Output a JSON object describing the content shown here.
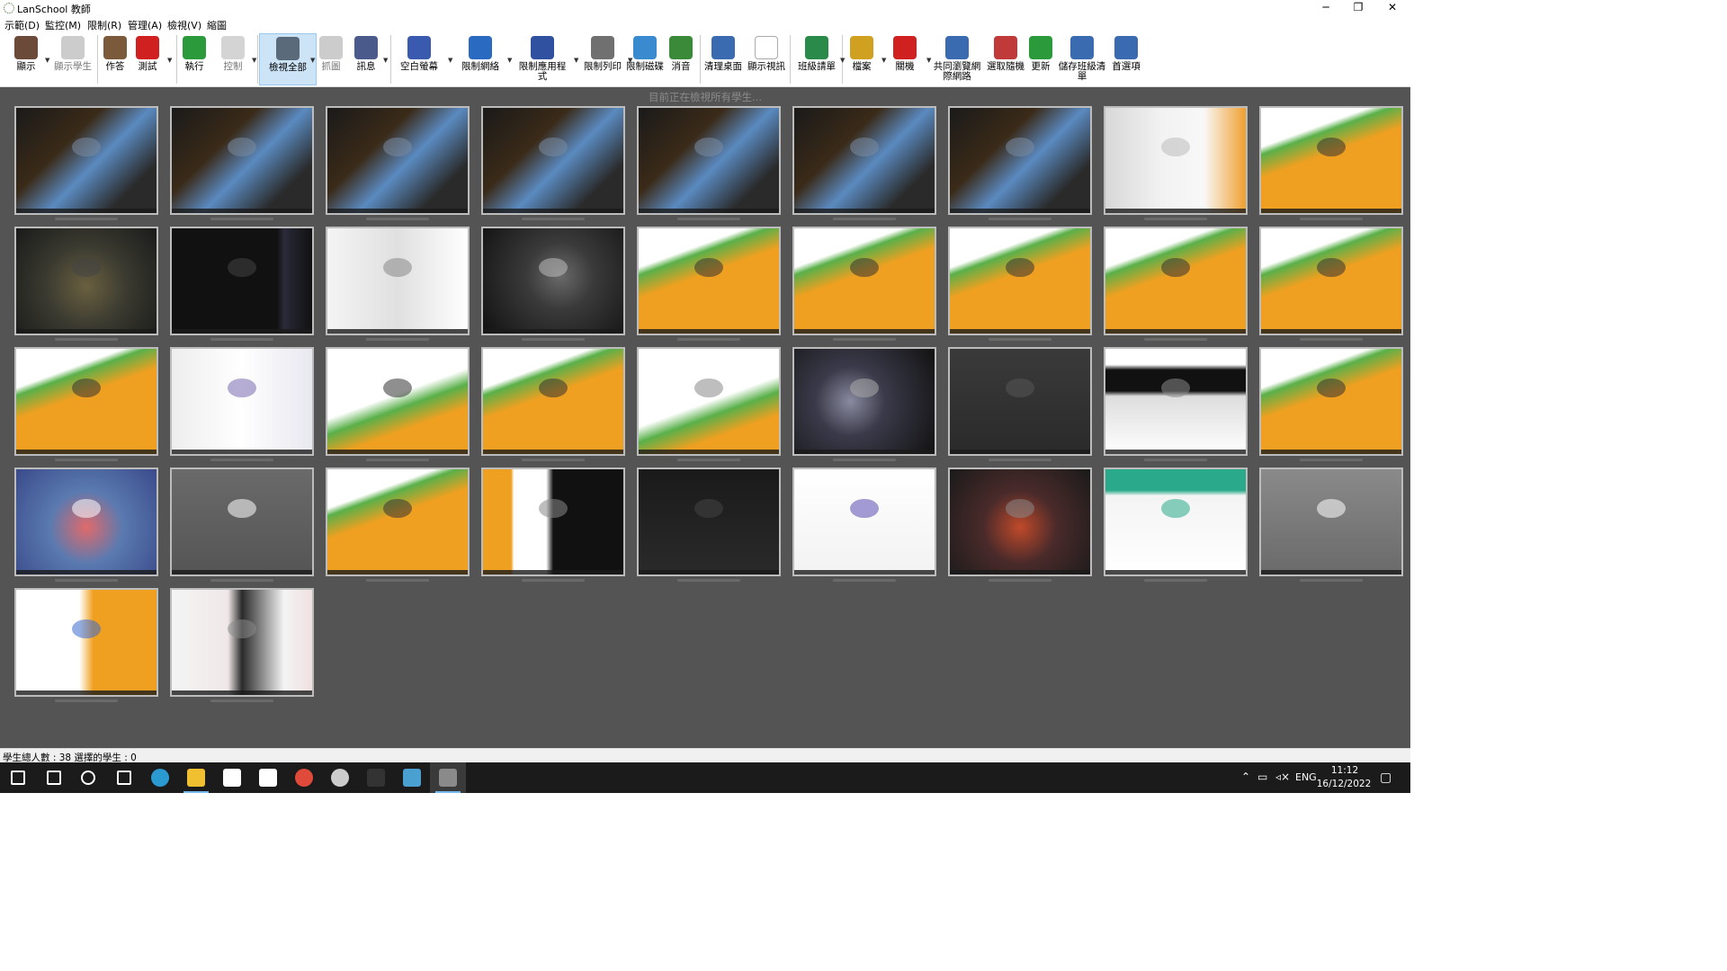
{
  "window": {
    "title": "LanSchool 教師",
    "minimize_glyph": "─",
    "maximize_glyph": "❐",
    "close_glyph": "✕"
  },
  "menu": [
    "示範(D)",
    "監控(M)",
    "限制(R)",
    "管理(A)",
    "檢視(V)",
    "縮圖"
  ],
  "toolbar": [
    {
      "label": "顯示",
      "icon": "presenter-icon",
      "color": "#6b4a3a",
      "arrow": true,
      "disabled": false
    },
    {
      "label": "顯示學生",
      "icon": "show-student-icon",
      "color": "#9a9a9a",
      "arrow": false,
      "disabled": true
    },
    {
      "label": "作答",
      "icon": "answer-icon",
      "color": "#7a5a3a",
      "arrow": false,
      "disabled": false
    },
    {
      "label": "測試",
      "icon": "test-icon",
      "color": "#d02020",
      "arrow": true,
      "disabled": false
    },
    {
      "label": "執行",
      "icon": "run-icon",
      "color": "#2a9a3a",
      "arrow": false,
      "disabled": false
    },
    {
      "label": "控制",
      "icon": "control-icon",
      "color": "#aaaaaa",
      "arrow": true,
      "disabled": true
    },
    {
      "label": "檢視全部",
      "icon": "view-all-icon",
      "color": "#5a6a7a",
      "arrow": true,
      "disabled": false,
      "active": true
    },
    {
      "label": "抓圖",
      "icon": "snapshot-icon",
      "color": "#999999",
      "arrow": false,
      "disabled": true
    },
    {
      "label": "訊息",
      "icon": "message-icon",
      "color": "#4a5a8a",
      "arrow": true,
      "disabled": false
    },
    {
      "label": "空白螢幕",
      "icon": "blank-screen-icon",
      "color": "#3a5ab0",
      "arrow": true,
      "disabled": false
    },
    {
      "label": "限制網絡",
      "icon": "limit-web-icon",
      "color": "#2a6ac0",
      "arrow": true,
      "disabled": false
    },
    {
      "label": "限制應用程式",
      "icon": "limit-apps-icon",
      "color": "#3050a0",
      "arrow": true,
      "disabled": false
    },
    {
      "label": "限制列印",
      "icon": "limit-print-icon",
      "color": "#707070",
      "arrow": true,
      "disabled": false
    },
    {
      "label": "限制磁碟",
      "icon": "limit-drive-icon",
      "color": "#3a8ad0",
      "arrow": false,
      "disabled": false
    },
    {
      "label": "消音",
      "icon": "mute-icon",
      "color": "#3a8a3a",
      "arrow": false,
      "disabled": false
    },
    {
      "label": "清理桌面",
      "icon": "clean-desktop-icon",
      "color": "#3a6ab0",
      "arrow": false,
      "disabled": false
    },
    {
      "label": "顯示視訊",
      "icon": "show-video-icon",
      "color": "#ffffff",
      "arrow": false,
      "disabled": false
    },
    {
      "label": "班級請單",
      "icon": "class-list-icon",
      "color": "#2a8a4a",
      "arrow": true,
      "disabled": false
    },
    {
      "label": "檔案",
      "icon": "files-icon",
      "color": "#d0a020",
      "arrow": true,
      "disabled": false
    },
    {
      "label": "關機",
      "icon": "shutdown-icon",
      "color": "#d02020",
      "arrow": true,
      "disabled": false
    },
    {
      "label": "共同瀏覽網際網路",
      "icon": "cobrowse-icon",
      "color": "#3a6ab0",
      "arrow": false,
      "disabled": false
    },
    {
      "label": "選取隨機",
      "icon": "random-icon",
      "color": "#c03a3a",
      "arrow": false,
      "disabled": false
    },
    {
      "label": "更新",
      "icon": "refresh-icon",
      "color": "#2a9a3a",
      "arrow": false,
      "disabled": false
    },
    {
      "label": "儲存班級清單",
      "icon": "save-list-icon",
      "color": "#3a6ab0",
      "arrow": false,
      "disabled": false
    },
    {
      "label": "首選項",
      "icon": "preferences-icon",
      "color": "#3a6ab0",
      "arrow": false,
      "disabled": false
    }
  ],
  "status_message": "目前正在檢視所有學生...",
  "thumbnails": [
    {
      "bg": "linear-gradient(135deg,#1a1a1a 0%,#3a2a18 35%,#5a8ac0 55%,#2a2a2a 80%)",
      "overlay": "#7a8aa0"
    },
    {
      "bg": "linear-gradient(135deg,#1a1a1a 0%,#3a2a18 35%,#5a8ac0 55%,#2a2a2a 80%)",
      "overlay": "#7a8aa0"
    },
    {
      "bg": "linear-gradient(135deg,#1a1a1a 0%,#3a2a18 35%,#5a8ac0 55%,#2a2a2a 80%)",
      "overlay": "#7a8aa0"
    },
    {
      "bg": "linear-gradient(135deg,#1a1a1a 0%,#3a2a18 35%,#5a8ac0 55%,#2a2a2a 80%)",
      "overlay": "#7a8aa0"
    },
    {
      "bg": "linear-gradient(135deg,#1a1a1a 0%,#3a2a18 35%,#5a8ac0 55%,#2a2a2a 80%)",
      "overlay": "#7a8aa0"
    },
    {
      "bg": "linear-gradient(135deg,#1a1a1a 0%,#3a2a18 35%,#5a8ac0 55%,#2a2a2a 80%)",
      "overlay": "#7a8aa0"
    },
    {
      "bg": "linear-gradient(135deg,#1a1a1a 0%,#3a2a18 35%,#5a8ac0 55%,#2a2a2a 80%)",
      "overlay": "#7a8aa0"
    },
    {
      "bg": "linear-gradient(90deg,#d8d8d8 0%,#f2f2f2 40%,#f8f8f8 70%,#f0a030 100%)",
      "overlay": "#bbbbbb"
    },
    {
      "bg": "linear-gradient(160deg,#ffffff 0%,#ffffff 25%,#5ab04a 30%,#f0a020 45%,#f0a020 100%)",
      "overlay": "#333333"
    },
    {
      "bg": "radial-gradient(circle at 50% 55%,#6a6040 0%,#3a3a30 45%,#1a1a1a 100%)",
      "overlay": "#444444"
    },
    {
      "bg": "linear-gradient(90deg,#111111 0%,#111111 75%,#2a2a3a 80%,#111111 100%)",
      "overlay": "#444444"
    },
    {
      "bg": "linear-gradient(90deg,#f4f4f4 0%,#e0e0e0 50%,#ffffff 100%)",
      "overlay": "#888888"
    },
    {
      "bg": "radial-gradient(circle at 55% 45%,#6a6a6a 0%,#3a3a3a 35%,#111111 100%)",
      "overlay": "#bbbbbb"
    },
    {
      "bg": "linear-gradient(160deg,#ffffff 0%,#ffffff 25%,#5ab04a 30%,#f0a020 45%,#f0a020 100%)",
      "overlay": "#333333"
    },
    {
      "bg": "linear-gradient(160deg,#ffffff 0%,#ffffff 25%,#5ab04a 30%,#f0a020 45%,#f0a020 100%)",
      "overlay": "#333333"
    },
    {
      "bg": "linear-gradient(160deg,#ffffff 0%,#ffffff 25%,#5ab04a 30%,#f0a020 45%,#f0a020 100%)",
      "overlay": "#333333"
    },
    {
      "bg": "linear-gradient(160deg,#ffffff 0%,#ffffff 25%,#5ab04a 30%,#f0a020 45%,#f0a020 100%)",
      "overlay": "#333333"
    },
    {
      "bg": "linear-gradient(160deg,#ffffff 0%,#ffffff 25%,#5ab04a 30%,#f0a020 45%,#f0a020 100%)",
      "overlay": "#333333"
    },
    {
      "bg": "linear-gradient(160deg,#ffffff 0%,#ffffff 25%,#5ab04a 30%,#f0a020 45%,#f0a020 100%)",
      "overlay": "#333333"
    },
    {
      "bg": "linear-gradient(90deg,#eeeeee 0%,#ffffff 50%,#e8e8f0 100%)",
      "overlay": "#7a6ab0"
    },
    {
      "bg": "linear-gradient(160deg,#ffffff 0%,#ffffff 45%,#5ab04a 55%,#f0a020 70%,#f0a020 100%)",
      "overlay": "#333333"
    },
    {
      "bg": "linear-gradient(160deg,#ffffff 0%,#ffffff 25%,#5ab04a 30%,#f0a020 45%,#f0a020 100%)",
      "overlay": "#333333"
    },
    {
      "bg": "linear-gradient(160deg,#ffffff 0%,#ffffff 50%,#5ab04a 60%,#f0a020 75%,#f0a020 100%)",
      "overlay": "#888888"
    },
    {
      "bg": "radial-gradient(circle at 40% 50%,#8a8aa0 0%,#3a3a4a 35%,#121212 100%)",
      "overlay": "#aaaaaa"
    },
    {
      "bg": "linear-gradient(180deg,#3a3a3a 0%,#2a2a2a 100%)",
      "overlay": "#555555"
    },
    {
      "bg": "linear-gradient(180deg,#ffffff 0%,#ffffff 15%,#111111 20%,#111111 40%,#dddddd 45%,#ffffff 100%)",
      "overlay": "#888888"
    },
    {
      "bg": "linear-gradient(160deg,#ffffff 0%,#ffffff 25%,#5ab04a 30%,#f0a020 45%,#f0a020 100%)",
      "overlay": "#333333"
    },
    {
      "bg": "radial-gradient(circle at 50% 55%,#e06a6a 0%,#5a7ab0 40%,#3a4a8a 100%)",
      "overlay": "#ffffff"
    },
    {
      "bg": "linear-gradient(180deg,#6a6a6a 0%,#555555 100%)",
      "overlay": "#ffffff"
    },
    {
      "bg": "linear-gradient(160deg,#ffffff 0%,#ffffff 25%,#5ab04a 30%,#f0a020 45%,#f0a020 100%)",
      "overlay": "#333333"
    },
    {
      "bg": "linear-gradient(90deg,#f0a020 0%,#f0a020 20%,#ffffff 22%,#ffffff 45%,#111111 50%,#111111 100%)",
      "overlay": "#888888"
    },
    {
      "bg": "linear-gradient(180deg,#1a1a1a 0%,#2a2a2a 100%)",
      "overlay": "#444444"
    },
    {
      "bg": "linear-gradient(180deg,#ffffff 0%,#f2f2f2 100%)",
      "overlay": "#5a4ab0"
    },
    {
      "bg": "radial-gradient(circle at 50% 55%,#c04a2a 0%,#4a2a2a 40%,#1a1a1a 100%)",
      "overlay": "#888888"
    },
    {
      "bg": "linear-gradient(180deg,#2aaa8a 0%,#2aaa8a 20%,#f4f4f4 25%,#ffffff 100%)",
      "overlay": "#2aaa8a"
    },
    {
      "bg": "linear-gradient(180deg,#8a8a8a 0%,#6a6a6a 100%)",
      "overlay": "#ffffff"
    },
    {
      "bg": "linear-gradient(90deg,#ffffff 0%,#ffffff 45%,#f0a020 55%,#f0a020 100%)",
      "overlay": "#3a6ad0"
    },
    {
      "bg": "linear-gradient(90deg,#f4f4f4 0%,#f0e8e8 40%,#2a2a2a 50%,#f4f4f4 80%,#f0e0e0 100%)",
      "overlay": "#888888"
    }
  ],
  "status_bar": "學生總人數 : 38  選擇的學生 : 0",
  "taskbar": {
    "apps": [
      {
        "icon": "windows-start-icon",
        "color": "#ffffff"
      },
      {
        "icon": "search-icon",
        "color": "#ffffff"
      },
      {
        "icon": "cortana-icon",
        "color": "#ffffff"
      },
      {
        "icon": "task-view-icon",
        "color": "#ffffff"
      },
      {
        "icon": "edge-icon",
        "color": "#2a9ad0"
      },
      {
        "icon": "file-explorer-icon",
        "color": "#f0c030"
      },
      {
        "icon": "store-icon",
        "color": "#ffffff"
      },
      {
        "icon": "mail-icon",
        "color": "#ffffff"
      },
      {
        "icon": "chrome-icon",
        "color": "#e04a3a"
      },
      {
        "icon": "clock-app-icon",
        "color": "#cccccc"
      },
      {
        "icon": "terminal-icon",
        "color": "#333333"
      },
      {
        "icon": "remote-desktop-icon",
        "color": "#4aa0d0"
      },
      {
        "icon": "lanschool-icon",
        "color": "#8a8a8a"
      }
    ],
    "lang": "ENG",
    "time": "11:12",
    "date": "16/12/2022"
  }
}
